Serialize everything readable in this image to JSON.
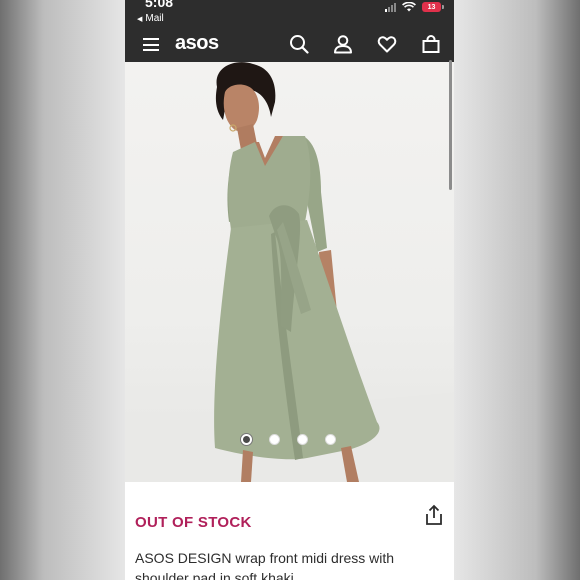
{
  "status_bar": {
    "time": "5:08",
    "back_app": "Mail",
    "battery": "13"
  },
  "header": {
    "logo": "asos",
    "icons": [
      "menu-icon",
      "search-icon",
      "account-icon",
      "heart-icon",
      "bag-icon"
    ]
  },
  "gallery": {
    "image_count": 4,
    "active_index": 0
  },
  "product": {
    "stock_status": "OUT OF STOCK",
    "title": "ASOS DESIGN wrap front midi dress with shoulder pad in soft khaki"
  },
  "colors": {
    "nav_bg": "#2d2d2d",
    "stock_status": "#b0205a",
    "dress": "#9fac8f"
  }
}
